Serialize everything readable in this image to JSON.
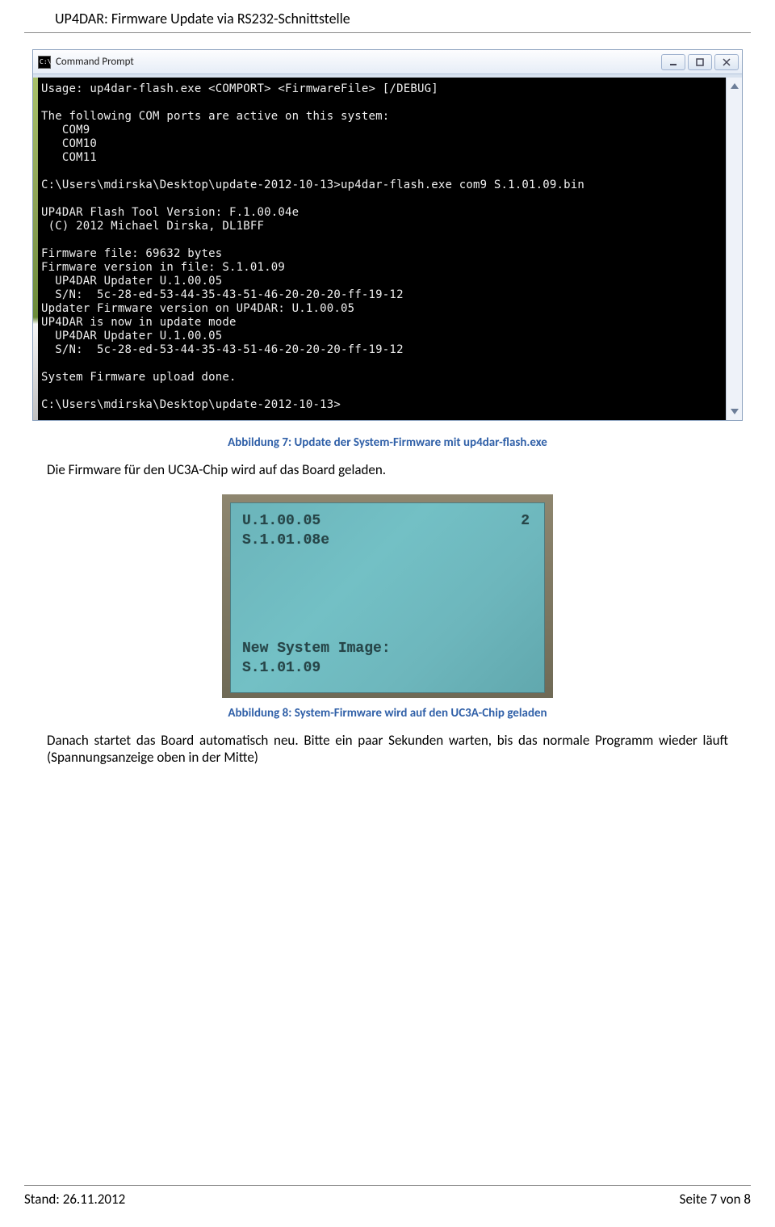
{
  "header_title": "UP4DAR: Firmware Update via RS232-Schnittstelle",
  "cmd": {
    "window_title": "Command Prompt",
    "lines": "Usage: up4dar-flash.exe <COMPORT> <FirmwareFile> [/DEBUG]\n\nThe following COM ports are active on this system:\n   COM9\n   COM10\n   COM11\n\nC:\\Users\\mdirska\\Desktop\\update-2012-10-13>up4dar-flash.exe com9 S.1.01.09.bin\n\nUP4DAR Flash Tool Version: F.1.00.04e\n (C) 2012 Michael Dirska, DL1BFF\n\nFirmware file: 69632 bytes\nFirmware version in file: S.1.01.09\n  UP4DAR Updater U.1.00.05\n  S/N:  5c-28-ed-53-44-35-43-51-46-20-20-20-ff-19-12\nUpdater Firmware version on UP4DAR: U.1.00.05\nUP4DAR is now in update mode\n  UP4DAR Updater U.1.00.05\n  S/N:  5c-28-ed-53-44-35-43-51-46-20-20-20-ff-19-12\n\nSystem Firmware upload done.\n\nC:\\Users\\mdirska\\Desktop\\update-2012-10-13>"
  },
  "caption1": "Abbildung 7:  Update der System-Firmware mit up4dar-flash.exe",
  "paragraph1": "Die Firmware für den UC3A-Chip wird auf das Board geladen.",
  "lcd": {
    "line1": "U.1.00.05",
    "line2": "S.1.01.08e",
    "top_right": "2",
    "mid1": "New System Image:",
    "mid2": "S.1.01.09"
  },
  "caption2": "Abbildung 8:  System-Firmware wird auf den UC3A-Chip geladen",
  "paragraph2": "Danach startet das Board automatisch neu. Bitte ein paar Sekunden warten, bis das normale Programm wieder läuft (Spannungsanzeige oben in der Mitte)",
  "footer": {
    "left": "Stand: 26.11.2012",
    "right": "Seite 7 von 8"
  }
}
